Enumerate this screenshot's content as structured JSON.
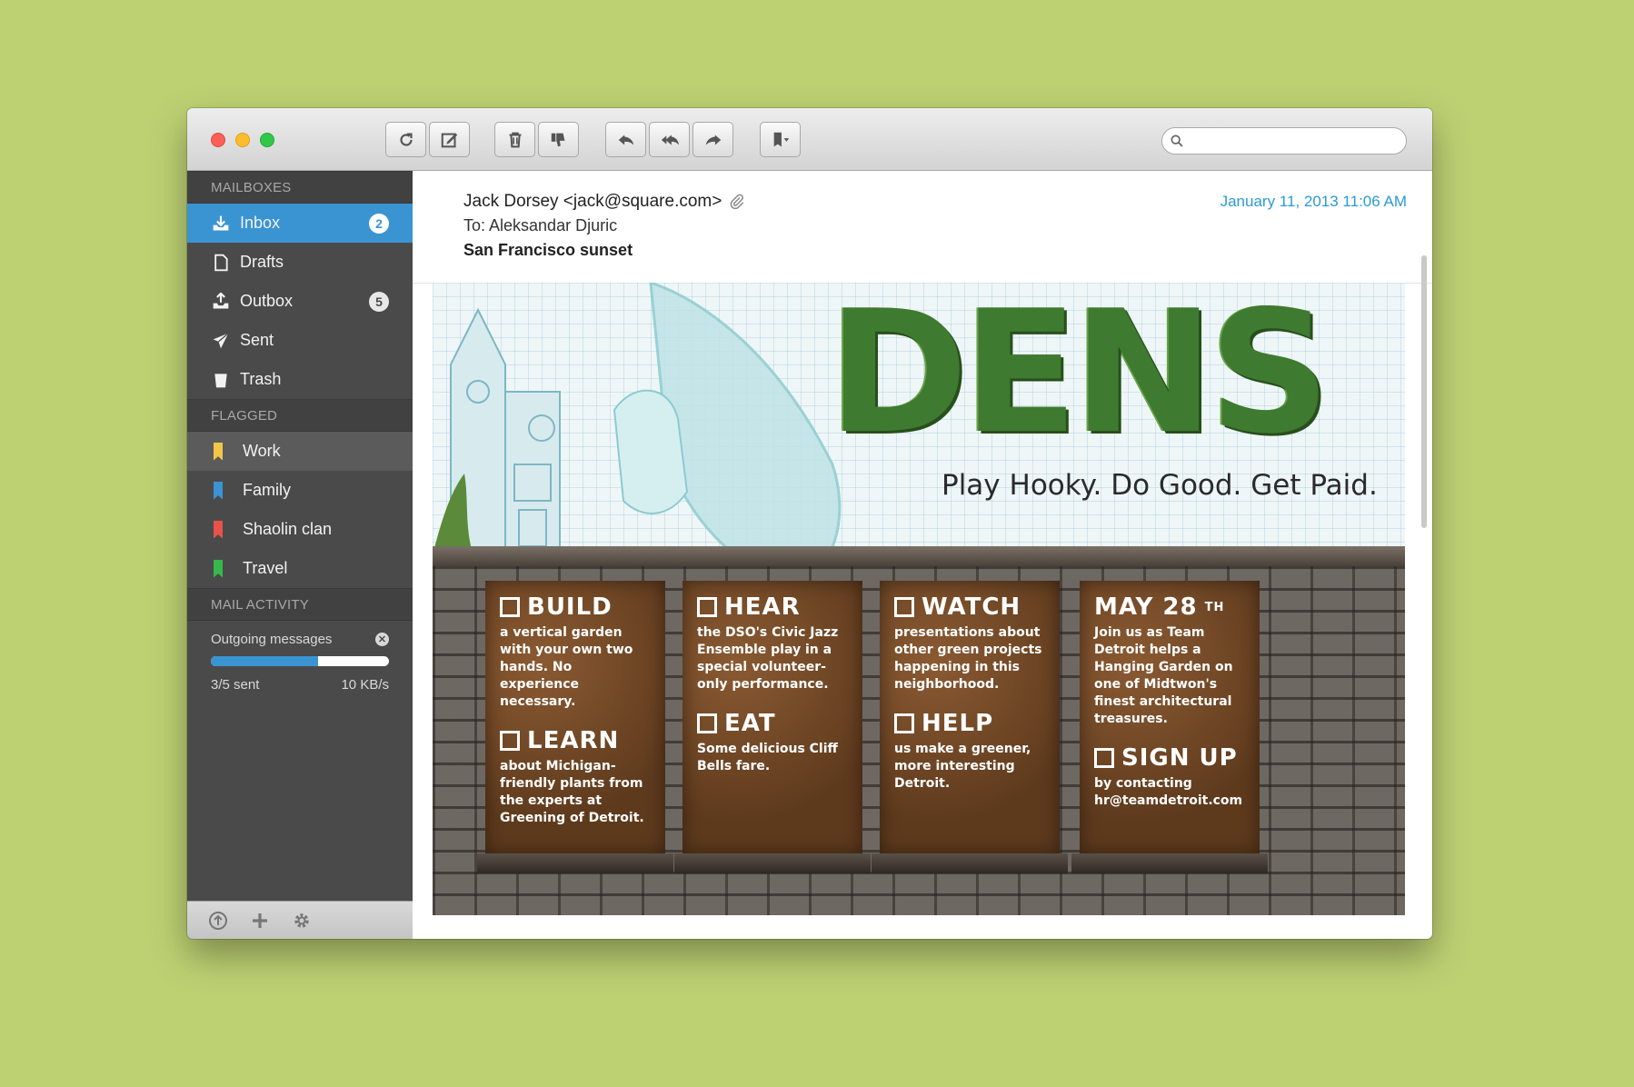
{
  "sidebar": {
    "mailboxes_heading": "MAILBOXES",
    "mailboxes": [
      {
        "label": "Inbox",
        "icon": "inbox-icon",
        "badge": "2"
      },
      {
        "label": "Drafts",
        "icon": "document-icon"
      },
      {
        "label": "Outbox",
        "icon": "outbox-icon",
        "badge": "5"
      },
      {
        "label": "Sent",
        "icon": "paper-plane-icon"
      },
      {
        "label": "Trash",
        "icon": "trash-icon"
      }
    ],
    "flagged_heading": "FLAGGED",
    "flagged": [
      {
        "label": "Work",
        "color": "#f3c64a"
      },
      {
        "label": "Family",
        "color": "#3b94d2"
      },
      {
        "label": "Shaolin clan",
        "color": "#e9524a"
      },
      {
        "label": "Travel",
        "color": "#36b84a"
      }
    ],
    "activity_heading": "MAIL ACTIVITY",
    "activity": {
      "label": "Outgoing messages",
      "progress_fraction": 0.6,
      "sent_count": "3/5 sent",
      "rate": "10 KB/s"
    }
  },
  "toolbar": {
    "search_placeholder": ""
  },
  "message": {
    "from": "Jack Dorsey <jack@square.com>",
    "to": "To: Aleksandar Djuric",
    "subject": "San Francisco sunset",
    "date": "January 11, 2013 11:06 AM"
  },
  "artwork": {
    "word": "DENS",
    "tagline": "Play Hooky. Do Good. Get Paid.",
    "panels": [
      {
        "items": [
          {
            "heading": "BUILD",
            "text": "a vertical garden with your own two hands. No experience necessary."
          },
          {
            "heading": "LEARN",
            "text": "about Michigan-friendly plants from the experts at Greening of Detroit."
          }
        ]
      },
      {
        "items": [
          {
            "heading": "HEAR",
            "text": "the DSO's Civic Jazz Ensemble play in a special volunteer-only performance."
          },
          {
            "heading": "EAT",
            "text": "Some delicious Cliff Bells fare."
          }
        ]
      },
      {
        "items": [
          {
            "heading": "WATCH",
            "text": "presentations about other green projects happening in this neighborhood."
          },
          {
            "heading": "HELP",
            "text": "us make a greener, more interesting Detroit."
          }
        ]
      }
    ],
    "may": {
      "heading": "MAY 28",
      "suffix": "TH",
      "text": "Join us as Team Detroit helps a Hanging Garden on one of Midtwon's finest architectural treasures.",
      "signup_heading": "SIGN UP",
      "signup_text": "by contacting hr@teamdetroit.com"
    }
  },
  "colors": {
    "accent": "#3b94d2",
    "date": "#2b9ad8",
    "background": "#bdd173"
  }
}
